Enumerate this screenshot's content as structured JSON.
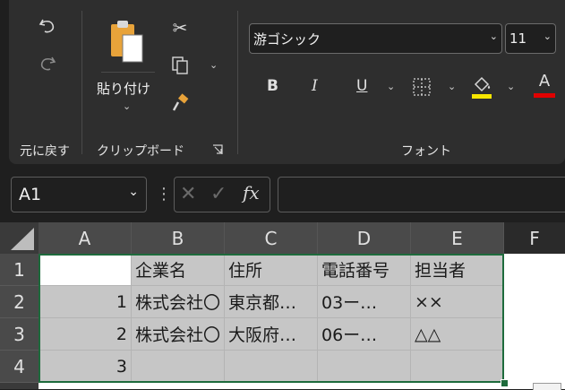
{
  "ribbon": {
    "undo_group_label": "元に戻す",
    "clipboard": {
      "paste_label": "貼り付け",
      "group_label": "クリップボード"
    },
    "font": {
      "font_name": "游ゴシック",
      "font_size": "11",
      "bold": "B",
      "italic": "I",
      "underline": "U",
      "font_color_glyph": "A",
      "group_label": "フォント",
      "highlight_color": "#f7e600",
      "font_color": "#e00000"
    }
  },
  "formula_bar": {
    "name_box": "A1",
    "fx_label": "fx",
    "value": ""
  },
  "grid": {
    "columns": [
      "A",
      "B",
      "C",
      "D",
      "E",
      "F"
    ],
    "rows": [
      "1",
      "2",
      "3",
      "4"
    ],
    "cells": [
      [
        "",
        "企業名",
        "住所",
        "電話番号",
        "担当者"
      ],
      [
        "1",
        "株式会社〇",
        "東京都…",
        "03ー…",
        "××"
      ],
      [
        "2",
        "株式会社〇",
        "大阪府…",
        "06ー…",
        "△△"
      ],
      [
        "3",
        "",
        "",
        "",
        ""
      ]
    ]
  }
}
